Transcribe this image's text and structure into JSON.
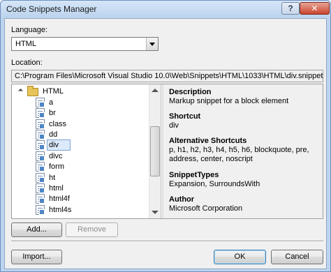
{
  "window": {
    "title": "Code Snippets Manager",
    "help_label": "?",
    "close_label": "✕"
  },
  "language": {
    "label": "Language:",
    "selected": "HTML"
  },
  "location": {
    "label": "Location:",
    "path": "C:\\Program Files\\Microsoft Visual Studio 10.0\\Web\\Snippets\\HTML\\1033\\HTML\\div.snippet"
  },
  "tree": {
    "root": "HTML",
    "items": [
      "a",
      "br",
      "class",
      "dd",
      "div",
      "divc",
      "form",
      "ht",
      "html",
      "html4f",
      "html4s"
    ],
    "selected": "div"
  },
  "details": {
    "description_label": "Description",
    "description": "Markup snippet for a block element",
    "shortcut_label": "Shortcut",
    "shortcut": "div",
    "alt_shortcuts_label": "Alternative Shortcuts",
    "alt_shortcuts": "p, h1, h2, h3, h4, h5, h6, blockquote, pre, address, center, noscript",
    "types_label": "SnippetTypes",
    "types": "Expansion, SurroundsWith",
    "author_label": "Author",
    "author": "Microsoft Corporation"
  },
  "buttons": {
    "add": "Add...",
    "remove": "Remove",
    "import": "Import...",
    "ok": "OK",
    "cancel": "Cancel"
  }
}
